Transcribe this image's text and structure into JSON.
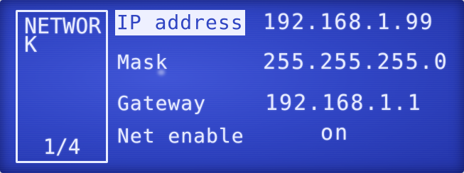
{
  "sidebar": {
    "title": "NETWORK",
    "page_indicator": "1/4"
  },
  "settings": {
    "ip_address": {
      "label": "IP address",
      "value": "192.168.1.99",
      "selected": true
    },
    "mask": {
      "label": "Mask",
      "value": "255.255.255.0"
    },
    "gateway": {
      "label": "Gateway",
      "value": "192.168.1.1"
    },
    "net_enable": {
      "label": "Net enable",
      "value": "on"
    }
  },
  "colors": {
    "screen_background": "#2f44c4",
    "text": "#e6eaff",
    "selection_background": "#eef0ff",
    "selection_text": "#2e43c2"
  }
}
